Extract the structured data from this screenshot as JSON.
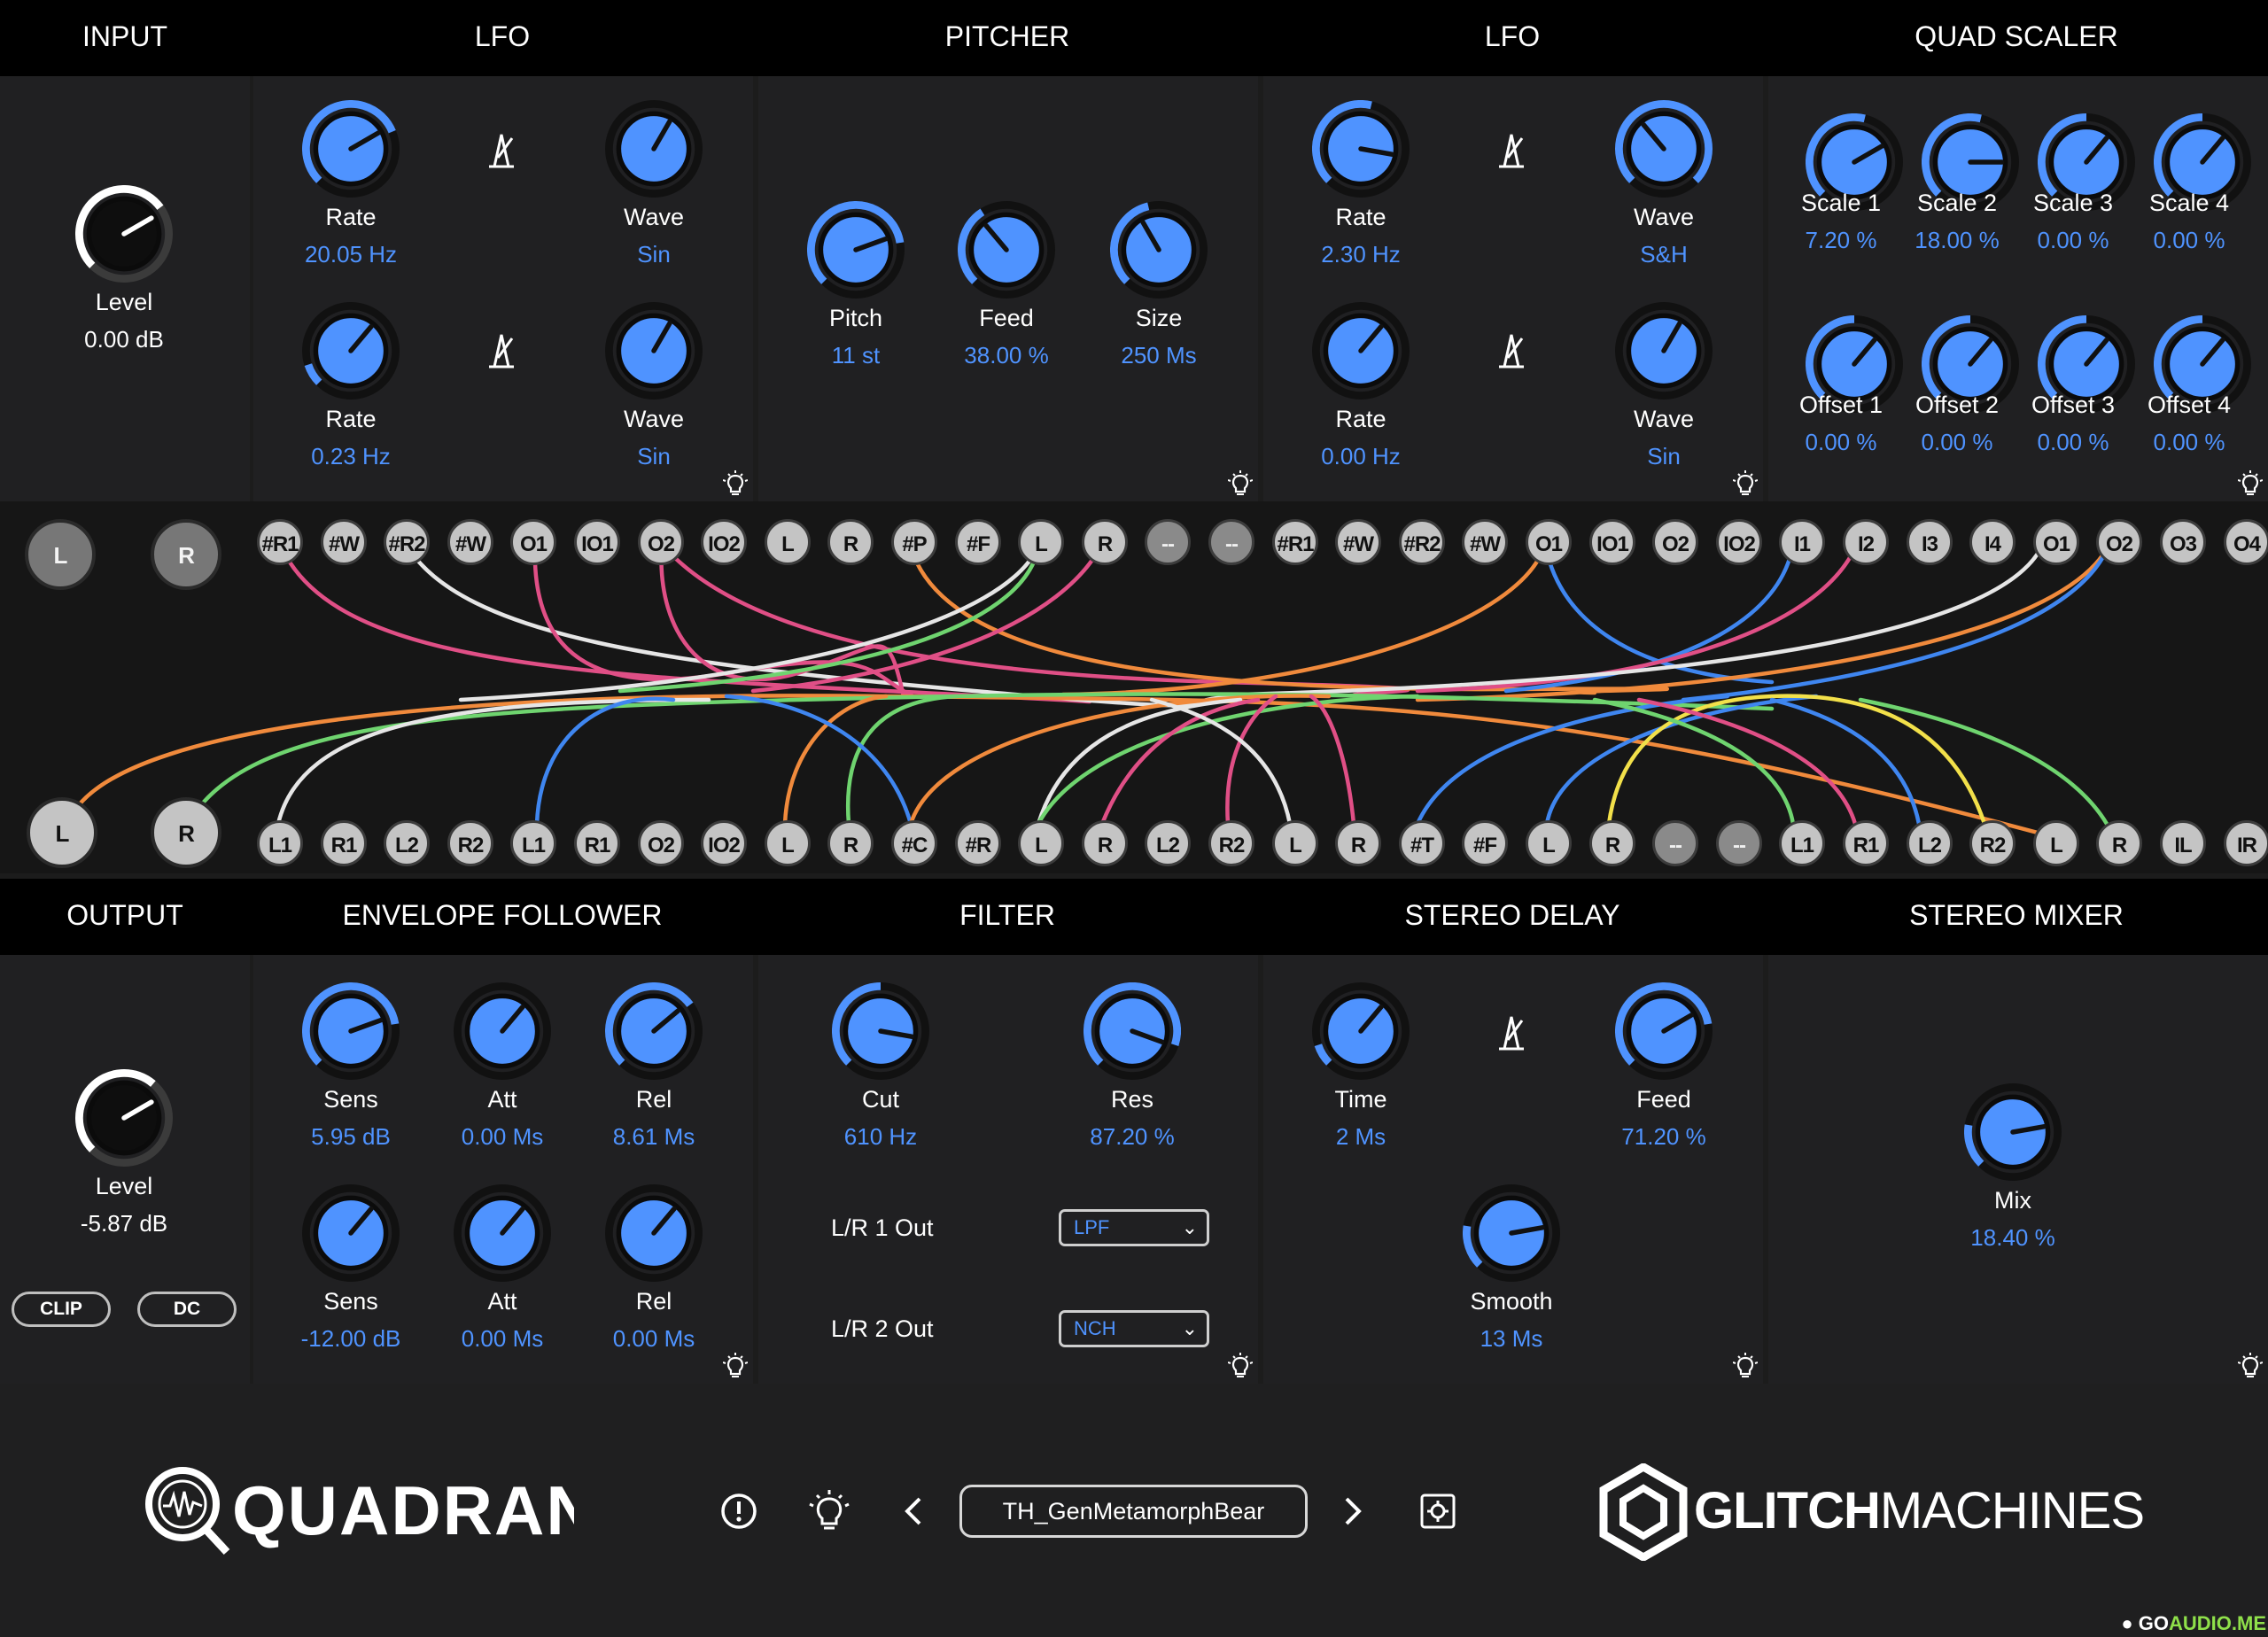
{
  "headers": {
    "input": "INPUT",
    "lfo1": "LFO",
    "pitcher": "PITCHER",
    "lfo2": "LFO",
    "quad_scaler": "QUAD SCALER",
    "output": "OUTPUT",
    "env": "ENVELOPE FOLLOWER",
    "filter": "FILTER",
    "delay": "STEREO DELAY",
    "mixer": "STEREO MIXER"
  },
  "input": {
    "label": "Level",
    "value": "0.00 dB"
  },
  "lfo1": {
    "rate1": {
      "label": "Rate",
      "value": "20.05 Hz"
    },
    "wave1": {
      "label": "Wave",
      "value": "Sin"
    },
    "rate2": {
      "label": "Rate",
      "value": "0.23 Hz"
    },
    "wave2": {
      "label": "Wave",
      "value": "Sin"
    }
  },
  "pitcher": {
    "pitch": {
      "label": "Pitch",
      "value": "11 st"
    },
    "feed": {
      "label": "Feed",
      "value": "38.00 %"
    },
    "size": {
      "label": "Size",
      "value": "250 Ms"
    }
  },
  "lfo2": {
    "rate1": {
      "label": "Rate",
      "value": "2.30 Hz"
    },
    "wave1": {
      "label": "Wave",
      "value": "S&H"
    },
    "rate2": {
      "label": "Rate",
      "value": "0.00 Hz"
    },
    "wave2": {
      "label": "Wave",
      "value": "Sin"
    }
  },
  "quad": {
    "scale1": {
      "label": "Scale 1",
      "value": "7.20 %"
    },
    "scale2": {
      "label": "Scale 2",
      "value": "18.00 %"
    },
    "scale3": {
      "label": "Scale 3",
      "value": "0.00 %"
    },
    "scale4": {
      "label": "Scale 4",
      "value": "0.00 %"
    },
    "offset1": {
      "label": "Offset 1",
      "value": "0.00 %"
    },
    "offset2": {
      "label": "Offset 2",
      "value": "0.00 %"
    },
    "offset3": {
      "label": "Offset 3",
      "value": "0.00 %"
    },
    "offset4": {
      "label": "Offset 4",
      "value": "0.00 %"
    }
  },
  "output": {
    "label": "Level",
    "value": "-5.87 dB",
    "clip": "CLIP",
    "dc": "DC"
  },
  "env": {
    "sens1": {
      "label": "Sens",
      "value": "5.95 dB"
    },
    "att1": {
      "label": "Att",
      "value": "0.00 Ms"
    },
    "rel1": {
      "label": "Rel",
      "value": "8.61 Ms"
    },
    "sens2": {
      "label": "Sens",
      "value": "-12.00 dB"
    },
    "att2": {
      "label": "Att",
      "value": "0.00 Ms"
    },
    "rel2": {
      "label": "Rel",
      "value": "0.00 Ms"
    }
  },
  "filter": {
    "cut": {
      "label": "Cut",
      "value": "610 Hz"
    },
    "res": {
      "label": "Res",
      "value": "87.20 %"
    },
    "lr1_label": "L/R 1 Out",
    "lr1_value": "LPF",
    "lr2_label": "L/R 2 Out",
    "lr2_value": "NCH"
  },
  "delay": {
    "time": {
      "label": "Time",
      "value": "2 Ms"
    },
    "feed": {
      "label": "Feed",
      "value": "71.20 %"
    },
    "smooth": {
      "label": "Smooth",
      "value": "13 Ms"
    }
  },
  "mixer": {
    "mix": {
      "label": "Mix",
      "value": "18.40 %"
    }
  },
  "patch": {
    "top_io": [
      "L",
      "R"
    ],
    "top_jacks": [
      "#R1",
      "#W",
      "#R2",
      "#W",
      "O1",
      "IO1",
      "O2",
      "IO2",
      "L",
      "R",
      "#P",
      "#F",
      "L",
      "R",
      "--",
      "--",
      "#R1",
      "#W",
      "#R2",
      "#W",
      "O1",
      "IO1",
      "O2",
      "IO2",
      "I1",
      "I2",
      "I3",
      "I4",
      "O1",
      "O2",
      "O3",
      "O4"
    ],
    "bottom_io": [
      "L",
      "R"
    ],
    "bottom_jacks": [
      "L1",
      "R1",
      "L2",
      "R2",
      "L1",
      "R1",
      "O2",
      "IO2",
      "L",
      "R",
      "#C",
      "#R",
      "L",
      "R",
      "L2",
      "R2",
      "L",
      "R",
      "#T",
      "#F",
      "L",
      "R",
      "--",
      "--",
      "L1",
      "R1",
      "L2",
      "R2",
      "L",
      "R",
      "IL",
      "IR"
    ]
  },
  "footer": {
    "logo": "QUADRANT",
    "preset": "TH_GenMetamorphBear",
    "brand_bold": "GLITCH",
    "brand_light": "MACHINES"
  },
  "watermark": {
    "prefix": "● GO",
    "suffix": "AUDIO.ME"
  },
  "colors": {
    "accent": "#4f93ff",
    "cable_pink": "#e04f86",
    "cable_white": "#e6e6e6",
    "cable_orange": "#f08a3c",
    "cable_green": "#6fd46f",
    "cable_blue": "#3f86f0",
    "cable_yellow": "#f2e04a"
  }
}
